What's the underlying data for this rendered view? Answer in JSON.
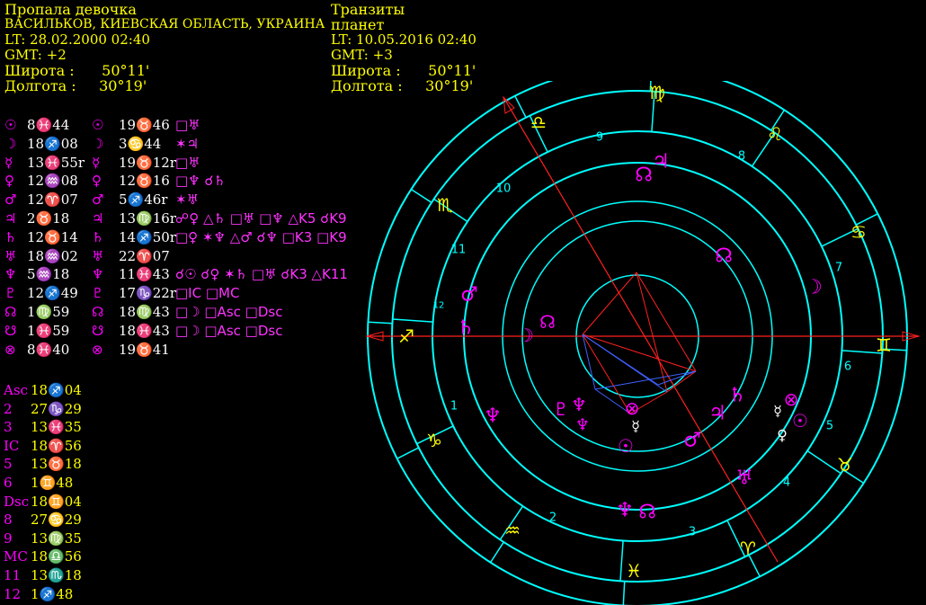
{
  "natal": {
    "title": "Пропала девочка",
    "place": "ВАСИЛЬКОВ, КИЕВСКАЯ ОБЛАСТЬ, УКРАИНА",
    "lt": "LT: 28.02.2000  02:40",
    "gmt": "GMT: +2",
    "lat": "Широта :      50°11'",
    "lon": "Долгота :     30°19'"
  },
  "transit": {
    "title": "Транзиты",
    "subtitle": "планет",
    "lt": "LT: 10.05.2016  02:40",
    "gmt": "GMT: +3",
    "lat": "Широта :      50°11'",
    "lon": "Долгота :     30°19'"
  },
  "planet_rows": [
    {
      "g1": "☉",
      "p1": "8♓44",
      "g2": "☉",
      "p2": "19♉46",
      "asp": "□♅"
    },
    {
      "g1": "☽",
      "p1": "18♐08",
      "g2": "☽",
      "p2": "3♋44",
      "asp": "✶♃"
    },
    {
      "g1": "☿",
      "p1": "13♓55r",
      "g2": "☿",
      "p2": "19♉12r",
      "asp": "□♅"
    },
    {
      "g1": "♀",
      "p1": "12♒08",
      "g2": "♀",
      "p2": "12♉16",
      "asp": "□♆ ☌♄"
    },
    {
      "g1": "♂",
      "p1": "12♈07",
      "g2": "♂",
      "p2": "5♐46r",
      "asp": "✶♅"
    },
    {
      "g1": "♃",
      "p1": "2♉18",
      "g2": "♃",
      "p2": "13♍16r",
      "asp": "☍♀ △♄ □♅ □♆ △K5 ☌K9"
    },
    {
      "g1": "♄",
      "p1": "12♉14",
      "g2": "♄",
      "p2": "14♐50r",
      "asp": "□♀ ✶♆ △♂ ☌♆ □K3 □K9"
    },
    {
      "g1": "♅",
      "p1": "18♒02",
      "g2": "♅",
      "p2": "22♈07",
      "asp": ""
    },
    {
      "g1": "♆",
      "p1": "5♒18",
      "g2": "♆",
      "p2": "11♓43",
      "asp": "☌☉ ☌♀ ✶♄ □♅ ☌K3 △K11"
    },
    {
      "g1": "♇",
      "p1": "12♐49",
      "g2": "♇",
      "p2": "17♑22r",
      "asp": "□IC □MC"
    },
    {
      "g1": "☊",
      "p1": "1♍59",
      "g2": "☊",
      "p2": "18♍43",
      "asp": "□☽ □Asc □Dsc"
    },
    {
      "g1": "☋",
      "p1": "1♓59",
      "g2": "☋",
      "p2": "18♓43",
      "asp": "□☽ □Asc □Dsc"
    },
    {
      "g1": "⊗",
      "p1": "8♓40",
      "g2": "⊗",
      "p2": "19♉41",
      "asp": ""
    }
  ],
  "houses": [
    {
      "label": "Asc",
      "value": "18♐04"
    },
    {
      "label": "2",
      "value": "27♑29"
    },
    {
      "label": "3",
      "value": "13♓35"
    },
    {
      "label": "IC",
      "value": "18♈56"
    },
    {
      "label": "5",
      "value": "13♉18"
    },
    {
      "label": "6",
      "value": "1♊48"
    },
    {
      "label": "Dsc",
      "value": "18♊04"
    },
    {
      "label": "8",
      "value": "27♋29"
    },
    {
      "label": "9",
      "value": "13♍35"
    },
    {
      "label": "MC",
      "value": "18♎56"
    },
    {
      "label": "11",
      "value": "13♏18"
    },
    {
      "label": "12",
      "value": "1♐48"
    }
  ],
  "wheel": {
    "zodiac_signs": [
      "♌",
      "♍",
      "♎",
      "♏",
      "♐",
      "♑",
      "♒",
      "♓",
      "♈",
      "♉",
      "♊",
      "♋"
    ],
    "house_numbers": [
      "1",
      "2",
      "3",
      "4",
      "5",
      "6",
      "7",
      "8",
      "9",
      "10",
      "11",
      "12"
    ],
    "outer_planets": [
      "♃",
      "☊",
      "☽",
      "♆",
      "♂",
      "♄",
      "♀",
      "☿",
      "⊗",
      "☉",
      "♂",
      "♅",
      "♆",
      "☊"
    ],
    "inner_planets": [
      "☊",
      "♆",
      "☽",
      "♇",
      "☿",
      "♆",
      "♀",
      "⊗",
      "☿",
      "☉"
    ],
    "colors": {
      "ring": "#00ffff",
      "glyph": "#ff00ff",
      "aspect_red": "#ff2020",
      "aspect_blue": "#4060ff",
      "text": "#ffff00",
      "white": "#ffffff"
    }
  }
}
